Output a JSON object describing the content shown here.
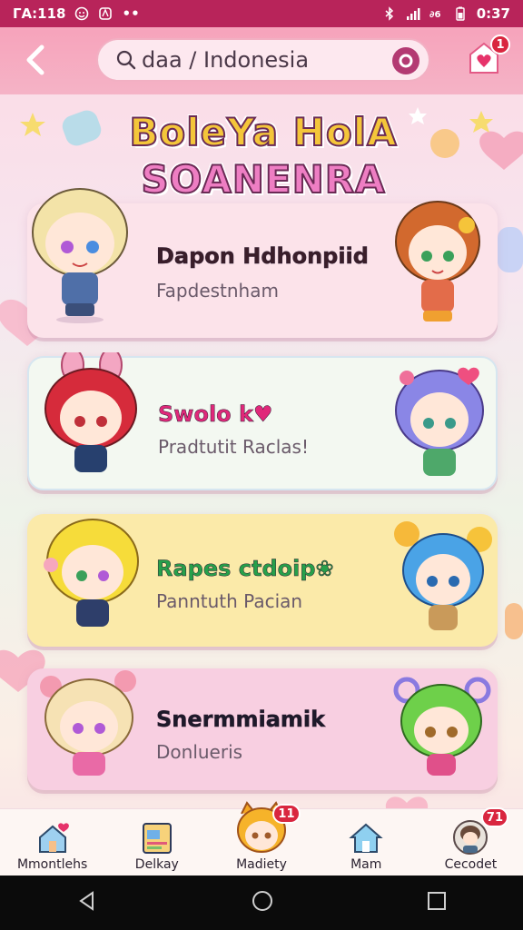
{
  "status_bar": {
    "time_left": "ГА:118",
    "time_right": "0:37"
  },
  "header": {
    "search_value": "daa / Indonesia",
    "notification_count": "1"
  },
  "title": {
    "line1": "BoleYa HolA",
    "line2": "SOANENRA"
  },
  "cards": [
    {
      "name": "Dapon Hdhonpiid",
      "subtitle": "Fapdestnham",
      "bg": "#fce3ea"
    },
    {
      "name": "Swolo k♥",
      "subtitle": "Pradtutit Raclas!",
      "bg": "#f3f8f1"
    },
    {
      "name": "Rapes ctdoip❀",
      "subtitle": "Panntuth Pacian",
      "bg": "#fbeaa9"
    },
    {
      "name": "Snermmiamik",
      "subtitle": "Donlueris",
      "bg": "#f8cfe1"
    }
  ],
  "bottom_nav": [
    {
      "label": "Mmontlehs",
      "badge": ""
    },
    {
      "label": "Delkay",
      "badge": ""
    },
    {
      "label": "Madiety",
      "badge": "11"
    },
    {
      "label": "Mam",
      "badge": ""
    },
    {
      "label": "Cecodet",
      "badge": "71"
    }
  ],
  "colors": {
    "status_bar": "#b8245a",
    "header": "#f6a3bb",
    "badge": "#d9263f"
  }
}
